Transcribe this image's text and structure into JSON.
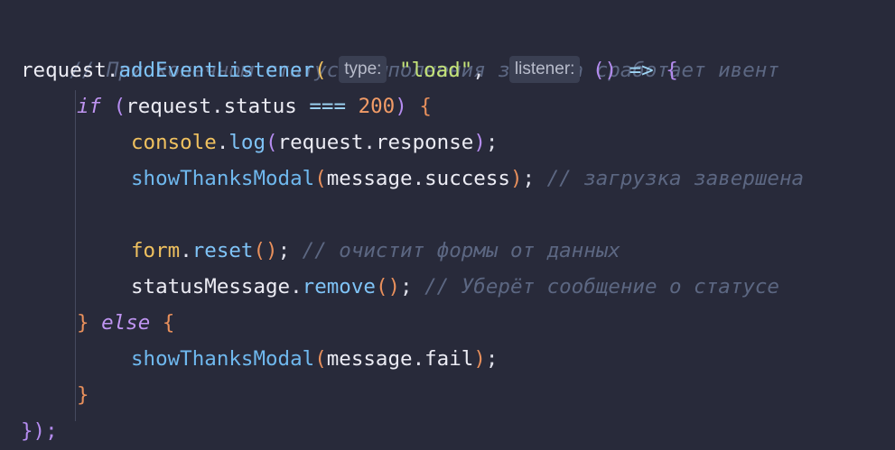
{
  "editor": {
    "lines": [
      {
        "comment": "// При конечном статусе выполнения запроса сработает ивент"
      },
      {
        "obj": "request",
        "dot": ".",
        "method": "addEventListener",
        "open": "(",
        "hint_type": "type:",
        "str": "\"load\"",
        "comma": ",",
        "hint_listener": "listener:",
        "arrow_params": "()",
        "arrow": "=>",
        "brace": "{"
      },
      {
        "kw": "if",
        "open": "(",
        "obj": "request",
        "dot": ".",
        "prop": "status",
        "op": "===",
        "num": "200",
        "close": ")",
        "brace": "{"
      },
      {
        "obj": "console",
        "dot": ".",
        "method": "log",
        "open": "(",
        "arg_obj": "request",
        "arg_dot": ".",
        "arg_prop": "response",
        "close": ")",
        "semi": ";"
      },
      {
        "func": "showThanksModal",
        "open": "(",
        "arg_obj": "message",
        "arg_dot": ".",
        "arg_prop": "success",
        "close": ")",
        "semi": ";",
        "comment": "// загрузка завершена"
      },
      {},
      {
        "obj": "form",
        "dot": ".",
        "method": "reset",
        "parens": "()",
        "semi": ";",
        "comment": "// очистит формы от данных"
      },
      {
        "obj": "statusMessage",
        "dot": ".",
        "method": "remove",
        "parens": "()",
        "semi": ";",
        "comment": "// Уберёт сообщение о статусе"
      },
      {
        "brace_close": "}",
        "kw": "else",
        "brace_open": "{"
      },
      {
        "func": "showThanksModal",
        "open": "(",
        "arg_obj": "message",
        "arg_dot": ".",
        "arg_prop": "fail",
        "close": ")",
        "semi": ";"
      },
      {
        "brace": "}"
      },
      {
        "close": "});"
      }
    ]
  },
  "colors": {
    "background": "#282a3a",
    "comment": "#5c6782",
    "function": "#6fb8ee",
    "string": "#c5e478",
    "number": "#f39c67",
    "keyword": "#c095f2",
    "brace": "#e9905c"
  }
}
